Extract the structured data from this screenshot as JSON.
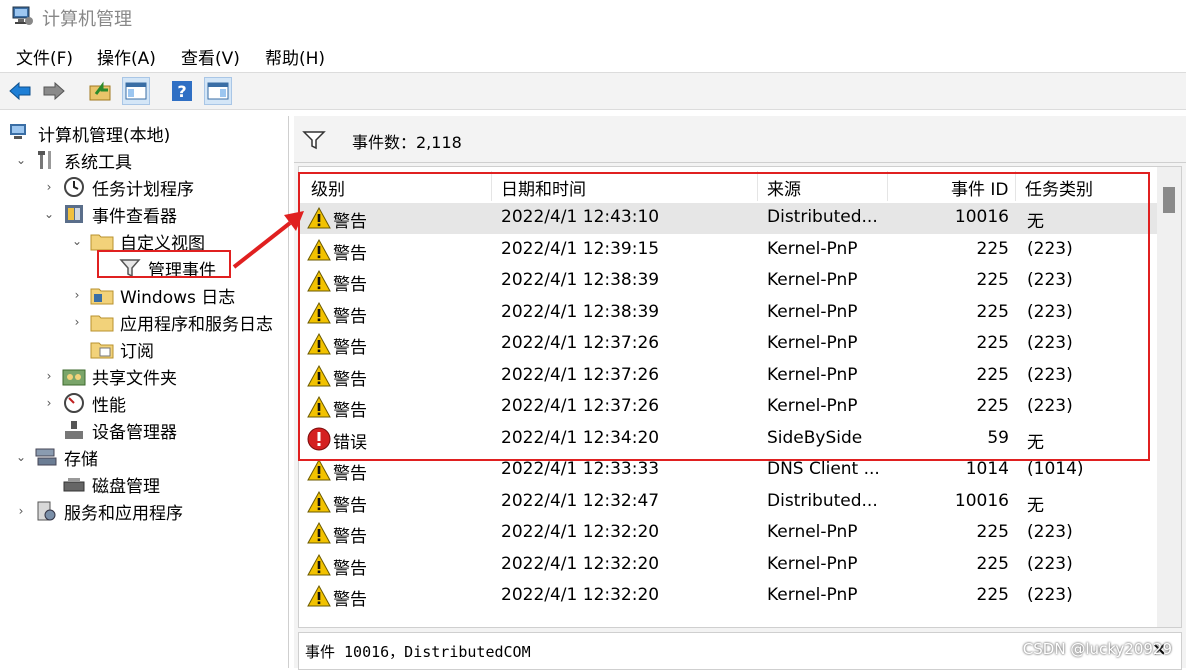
{
  "window": {
    "title": "计算机管理"
  },
  "menu": [
    "文件(F)",
    "操作(A)",
    "查看(V)",
    "帮助(H)"
  ],
  "toolbar": [
    "back-icon",
    "forward-icon",
    "up-folder-icon",
    "show-hide-tree-icon",
    "help-icon",
    "show-hide-action-pane-icon"
  ],
  "tree": {
    "root": "计算机管理(本地)",
    "system_tools": "系统工具",
    "task_scheduler": "任务计划程序",
    "event_viewer": "事件查看器",
    "custom_views": "自定义视图",
    "admin_events": "管理事件",
    "windows_logs": "Windows 日志",
    "app_service_logs": "应用程序和服务日志",
    "subscriptions": "订阅",
    "shared_folders": "共享文件夹",
    "performance": "性能",
    "device_manager": "设备管理器",
    "storage": "存储",
    "disk_management": "磁盘管理",
    "services_apps": "服务和应用程序"
  },
  "events": {
    "count_label": "事件数：2,118",
    "columns": {
      "level": "级别",
      "datetime": "日期和时间",
      "source": "来源",
      "event_id": "事件 ID",
      "task": "任务类别"
    },
    "rows": [
      {
        "type": "warning",
        "level": "警告",
        "datetime": "2022/4/1 12:43:10",
        "source": "Distributed...",
        "event_id": "10016",
        "task": "无"
      },
      {
        "type": "warning",
        "level": "警告",
        "datetime": "2022/4/1 12:39:15",
        "source": "Kernel-PnP",
        "event_id": "225",
        "task": "(223)"
      },
      {
        "type": "warning",
        "level": "警告",
        "datetime": "2022/4/1 12:38:39",
        "source": "Kernel-PnP",
        "event_id": "225",
        "task": "(223)"
      },
      {
        "type": "warning",
        "level": "警告",
        "datetime": "2022/4/1 12:38:39",
        "source": "Kernel-PnP",
        "event_id": "225",
        "task": "(223)"
      },
      {
        "type": "warning",
        "level": "警告",
        "datetime": "2022/4/1 12:37:26",
        "source": "Kernel-PnP",
        "event_id": "225",
        "task": "(223)"
      },
      {
        "type": "warning",
        "level": "警告",
        "datetime": "2022/4/1 12:37:26",
        "source": "Kernel-PnP",
        "event_id": "225",
        "task": "(223)"
      },
      {
        "type": "warning",
        "level": "警告",
        "datetime": "2022/4/1 12:37:26",
        "source": "Kernel-PnP",
        "event_id": "225",
        "task": "(223)"
      },
      {
        "type": "error",
        "level": "错误",
        "datetime": "2022/4/1 12:34:20",
        "source": "SideBySide",
        "event_id": "59",
        "task": "无"
      },
      {
        "type": "warning",
        "level": "警告",
        "datetime": "2022/4/1 12:33:33",
        "source": "DNS Client ...",
        "event_id": "1014",
        "task": "(1014)"
      },
      {
        "type": "warning",
        "level": "警告",
        "datetime": "2022/4/1 12:32:47",
        "source": "Distributed...",
        "event_id": "10016",
        "task": "无"
      },
      {
        "type": "warning",
        "level": "警告",
        "datetime": "2022/4/1 12:32:20",
        "source": "Kernel-PnP",
        "event_id": "225",
        "task": "(223)"
      },
      {
        "type": "warning",
        "level": "警告",
        "datetime": "2022/4/1 12:32:20",
        "source": "Kernel-PnP",
        "event_id": "225",
        "task": "(223)"
      },
      {
        "type": "warning",
        "level": "警告",
        "datetime": "2022/4/1 12:32:20",
        "source": "Kernel-PnP",
        "event_id": "225",
        "task": "(223)"
      }
    ]
  },
  "detail": {
    "title": "事件 10016，DistributedCOM",
    "close": "×"
  },
  "watermark": "CSDN @lucky20929",
  "colors": {
    "annotation": "#e02020",
    "warning": "#f2c200",
    "error": "#d42020",
    "selection": "#e6e6e6"
  }
}
